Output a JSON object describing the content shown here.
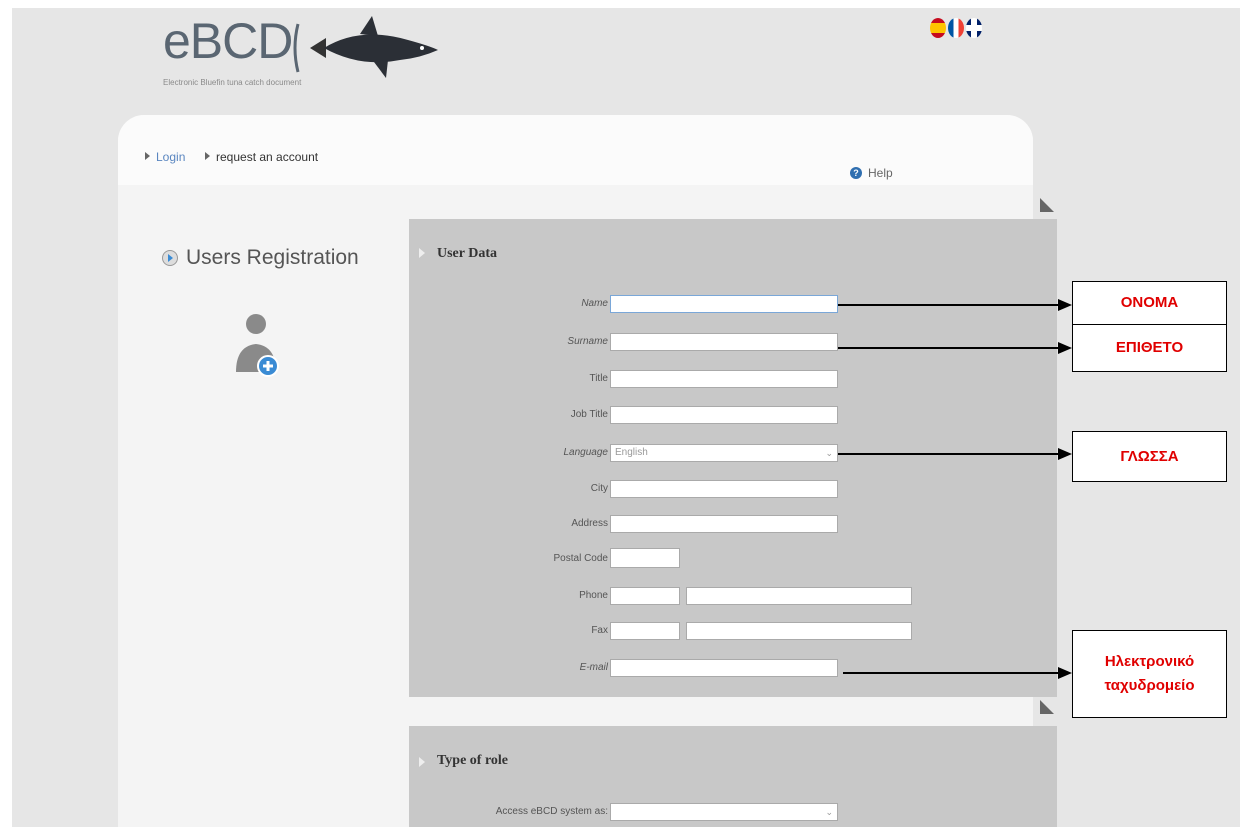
{
  "logo": {
    "title": "eBCD",
    "subtitle": "Electronic Bluefin tuna catch document"
  },
  "languages": [
    "es-flag-icon",
    "fr-flag-icon",
    "uk-flag-icon"
  ],
  "breadcrumb": {
    "login": "Login",
    "current": "request an account"
  },
  "help": "Help",
  "sidebar": {
    "title": "Users Registration"
  },
  "user_data": {
    "title": "User Data",
    "fields": {
      "name": "Name",
      "surname": "Surname",
      "title": "Title",
      "job_title": "Job Title",
      "language": "Language",
      "language_value": "English",
      "city": "City",
      "address": "Address",
      "postal_code": "Postal Code",
      "phone": "Phone",
      "fax": "Fax",
      "email": "E-mail"
    }
  },
  "role": {
    "title": "Type of role",
    "access_label": "Access eBCD system as:"
  },
  "annotations": {
    "name": "ΟΝΟΜΑ",
    "surname": "ΕΠΙΘΕΤΟ",
    "language": "ΓΛΩΣΣΑ",
    "email": "Ηλεκτρονικό ταχυδρομείο"
  }
}
